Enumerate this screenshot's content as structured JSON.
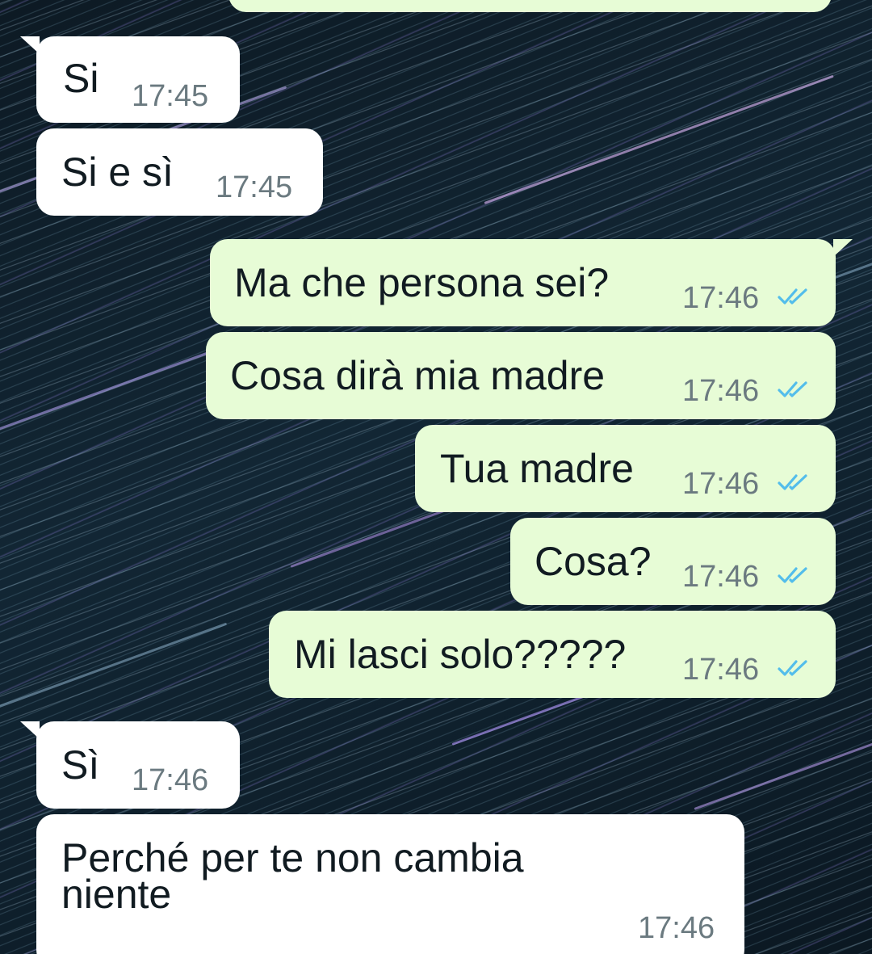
{
  "colors": {
    "incoming_bubble": "#ffffff",
    "outgoing_bubble": "#e7fcd6",
    "read_ticks": "#53bdeb",
    "time_text": "#6b7a80"
  },
  "icons": {
    "read_receipt": "double-check-icon"
  },
  "messages": [
    {
      "direction": "in",
      "text": "Si",
      "time": "17:45"
    },
    {
      "direction": "in",
      "text": "Si e sì",
      "time": "17:45"
    },
    {
      "direction": "out",
      "text": "Ma che persona sei?",
      "time": "17:46",
      "status": "read"
    },
    {
      "direction": "out",
      "text": "Cosa dirà mia madre",
      "time": "17:46",
      "status": "read"
    },
    {
      "direction": "out",
      "text": "Tua madre",
      "time": "17:46",
      "status": "read"
    },
    {
      "direction": "out",
      "text": "Cosa?",
      "time": "17:46",
      "status": "read"
    },
    {
      "direction": "out",
      "text": "Mi lasci solo?????",
      "time": "17:46",
      "status": "read"
    },
    {
      "direction": "in",
      "text": "Sì",
      "time": "17:46"
    },
    {
      "direction": "in",
      "text_line1": "Perché per te non cambia",
      "text_line2": "niente",
      "time": "17:46"
    }
  ]
}
